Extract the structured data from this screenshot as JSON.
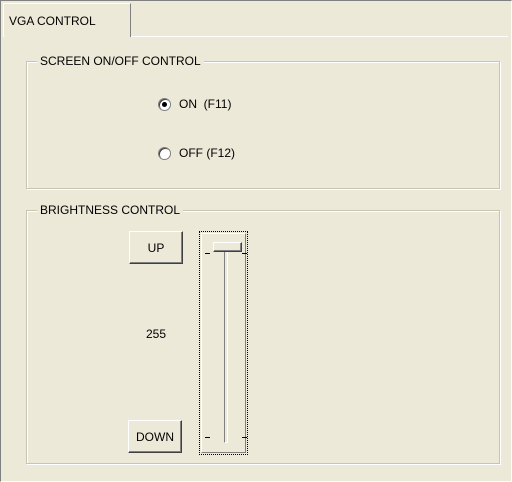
{
  "tab": {
    "label": "VGA CONTROL"
  },
  "screen_group": {
    "title": "SCREEN ON/OFF CONTROL",
    "options": [
      {
        "label": "ON  (F11)",
        "selected": true
      },
      {
        "label": "OFF (F12)",
        "selected": false
      }
    ]
  },
  "brightness_group": {
    "title": "BRIGHTNESS CONTROL",
    "up_label": "UP",
    "down_label": "DOWN",
    "value": "255",
    "level_fraction": 1.0
  }
}
